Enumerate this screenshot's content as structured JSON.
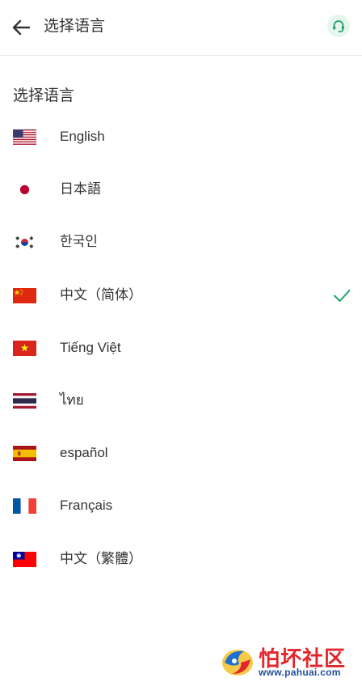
{
  "header": {
    "title": "选择语言",
    "back_icon": "arrow-left-icon",
    "support_icon": "headset-icon",
    "accent_color": "#22a06b"
  },
  "section_title": "选择语言",
  "languages": [
    {
      "label": "English",
      "flag": "us-flag-icon"
    },
    {
      "label": "日本語",
      "flag": "japan-flag-icon"
    },
    {
      "label": "한국인",
      "flag": "korea-flag-icon"
    },
    {
      "label": "中文（简体）",
      "flag": "china-flag-icon",
      "selected": true
    },
    {
      "label": "Tiếng Việt",
      "flag": "vietnam-flag-icon"
    },
    {
      "label": "ไทย",
      "flag": "thailand-flag-icon"
    },
    {
      "label": "español",
      "flag": "spain-flag-icon"
    },
    {
      "label": "Français",
      "flag": "france-flag-icon"
    },
    {
      "label": "中文（繁體）",
      "flag": "taiwan-flag-icon"
    }
  ],
  "check_icon": "checkmark-icon",
  "watermark": {
    "name": "怕坏社区",
    "url": "www.pahuai.com"
  }
}
